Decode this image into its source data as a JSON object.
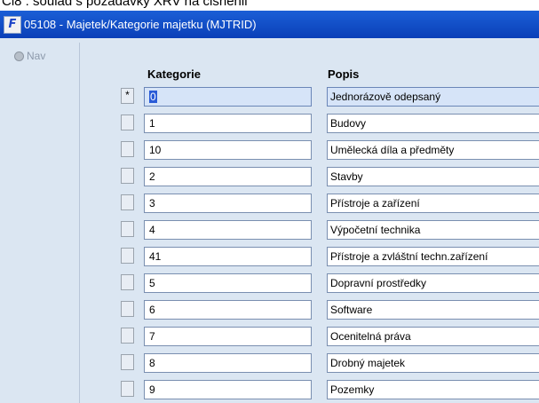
{
  "caption": "Ci8 : soulad s pozadavky XRV na cisnenii",
  "window": {
    "title": "05108 - Majetek/Kategorie majetku (MJTRID)",
    "app_icon": "F"
  },
  "side": {
    "nav_label": "Nav"
  },
  "table": {
    "headers": {
      "kategorie": "Kategorie",
      "popis": "Popis"
    },
    "current_marker": "*",
    "rows": [
      {
        "kat": "0",
        "popis": "Jednorázově odepsaný"
      },
      {
        "kat": "1",
        "popis": "Budovy"
      },
      {
        "kat": "10",
        "popis": "Umělecká díla a předměty"
      },
      {
        "kat": "2",
        "popis": "Stavby"
      },
      {
        "kat": "3",
        "popis": "Přístroje a zařízení"
      },
      {
        "kat": "4",
        "popis": "Výpočetní technika"
      },
      {
        "kat": "41",
        "popis": "Přístroje a zvláštní  techn.zařízení"
      },
      {
        "kat": "5",
        "popis": "Dopravní prostředky"
      },
      {
        "kat": "6",
        "popis": "Software"
      },
      {
        "kat": "7",
        "popis": "Ocenitelná práva"
      },
      {
        "kat": "8",
        "popis": "Drobný majetek"
      },
      {
        "kat": "9",
        "popis": "Pozemky"
      }
    ]
  },
  "colors": {
    "titlebar": "#0a3fb8",
    "panel": "#dbe6f2",
    "selection": "#2a5bd7"
  }
}
